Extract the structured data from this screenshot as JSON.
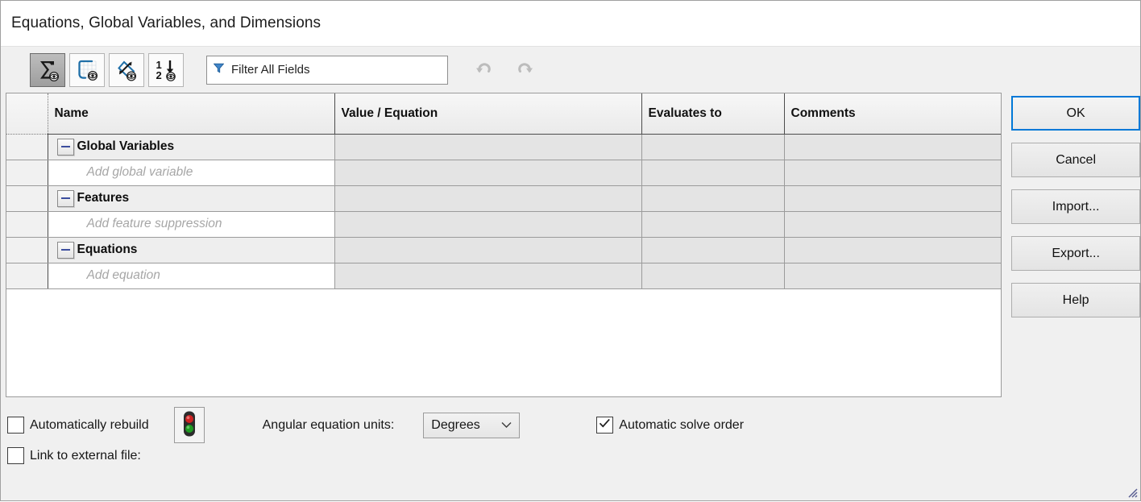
{
  "window": {
    "title": "Equations, Global Variables, and Dimensions"
  },
  "toolbar": {
    "buttons": [
      {
        "name": "equation-view-button",
        "icon": "sigma-eye-icon",
        "active": true
      },
      {
        "name": "sketch-equation-view-button",
        "icon": "sketch-eye-icon",
        "active": false
      },
      {
        "name": "dimension-view-button",
        "icon": "dimension-eye-icon",
        "active": false
      },
      {
        "name": "ordered-view-button",
        "icon": "ordered-eye-icon",
        "active": false
      }
    ],
    "filter": {
      "icon": "filter-funnel-icon",
      "value": "Filter All Fields",
      "placeholder": "Filter All Fields"
    },
    "undo_label": "Undo",
    "redo_label": "Redo",
    "undo_icon": "undo-arrow-icon",
    "redo_icon": "redo-arrow-icon"
  },
  "grid": {
    "columns": [
      "",
      "Name",
      "Value / Equation",
      "Evaluates to",
      "Comments"
    ],
    "rows": [
      {
        "type": "group",
        "name": "Global Variables",
        "value": "",
        "evaluates": "",
        "comments": "",
        "expander": "collapse-minus-icon"
      },
      {
        "type": "add",
        "name": "Add global variable",
        "value": "",
        "evaluates": "",
        "comments": ""
      },
      {
        "type": "group",
        "name": "Features",
        "value": "",
        "evaluates": "",
        "comments": "",
        "expander": "collapse-minus-icon"
      },
      {
        "type": "add",
        "name": "Add feature suppression",
        "value": "",
        "evaluates": "",
        "comments": ""
      },
      {
        "type": "group",
        "name": "Equations",
        "value": "",
        "evaluates": "",
        "comments": "",
        "expander": "collapse-minus-icon"
      },
      {
        "type": "add",
        "name": "Add equation",
        "value": "",
        "evaluates": "",
        "comments": ""
      }
    ]
  },
  "side_buttons": {
    "ok": "OK",
    "cancel": "Cancel",
    "import": "Import...",
    "export": "Export...",
    "help": "Help"
  },
  "footer": {
    "auto_rebuild_label": "Automatically rebuild",
    "auto_rebuild_checked": false,
    "traffic_light_icon": "traffic-light-icon",
    "angular_units_label": "Angular equation units:",
    "angular_units_value": "Degrees",
    "angular_units_caret": "chevron-down-icon",
    "auto_solve_label": "Automatic solve order",
    "auto_solve_checked": true,
    "link_external_label": "Link to external file:",
    "link_external_checked": false,
    "resize_grip_icon": "resize-grip-icon"
  },
  "colors": {
    "focus_border": "#0078d7",
    "expander_blue": "#3c4e9e",
    "filter_blue": "#3f84c8",
    "traffic_red": "#cf2222",
    "traffic_green": "#1f9c22",
    "placeholder_gray": "#a6a6a6"
  }
}
